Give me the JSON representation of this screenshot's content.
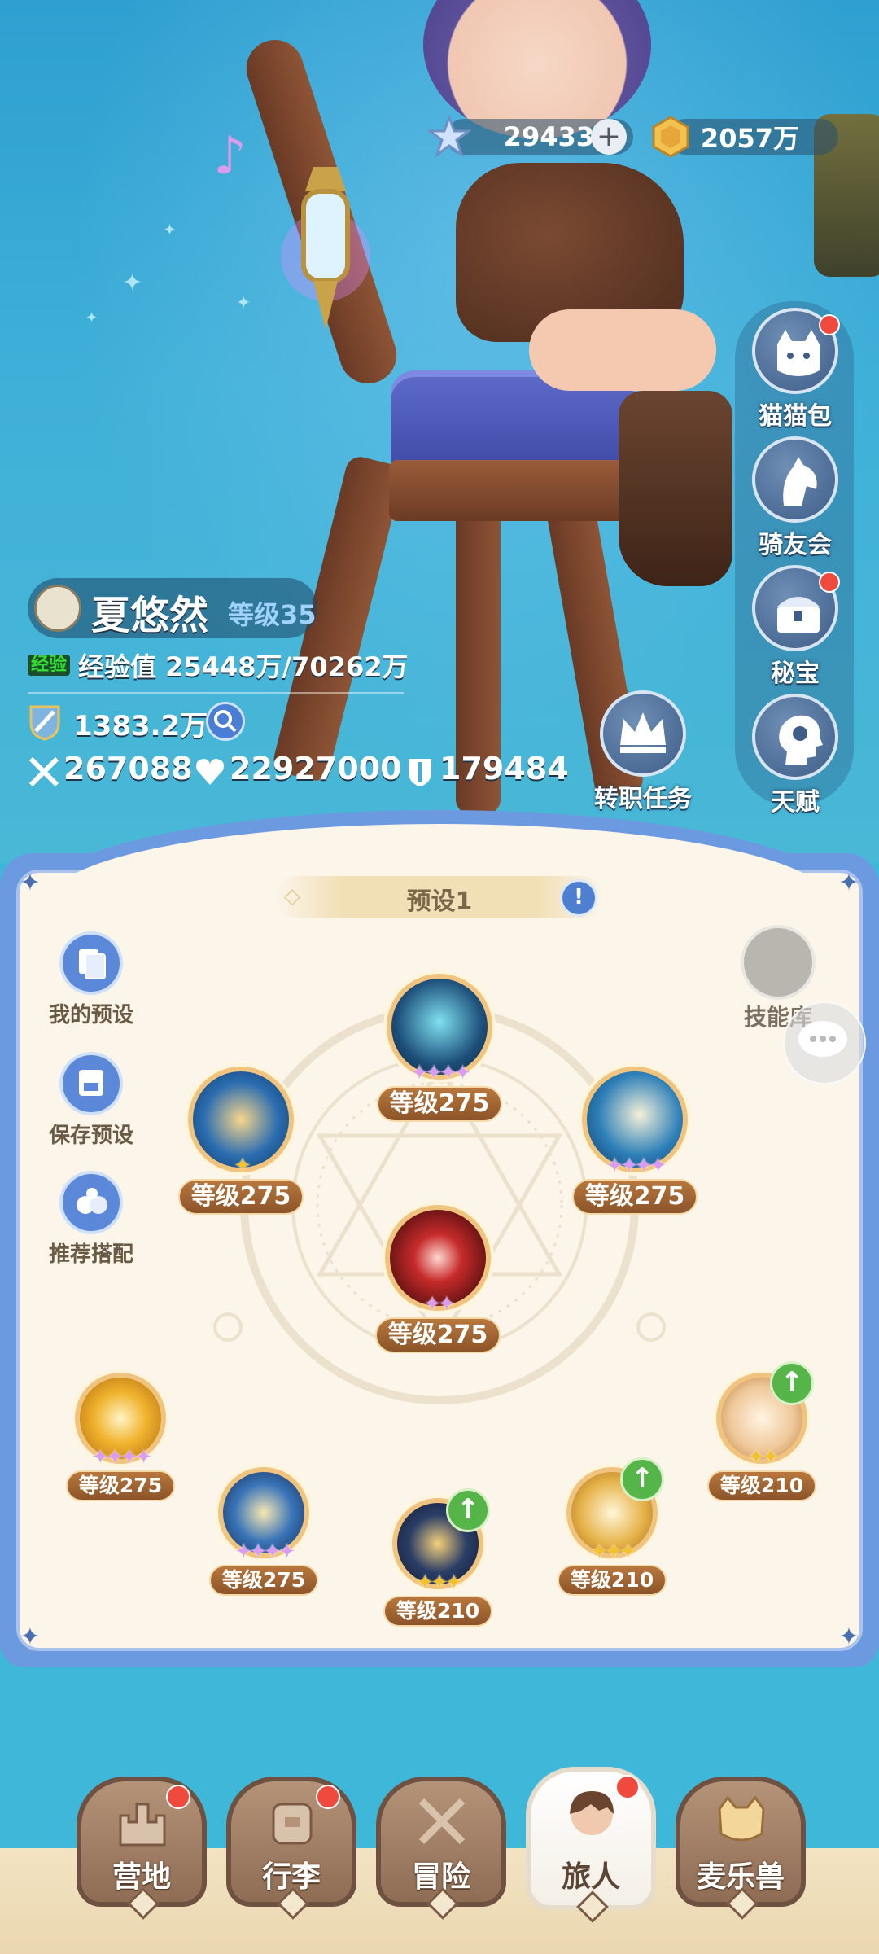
{
  "currency": {
    "stars": "29433",
    "gold": "2057万"
  },
  "side_menu": [
    {
      "label": "猫猫包",
      "badge": true
    },
    {
      "label": "骑友会",
      "badge": false
    },
    {
      "label": "秘宝",
      "badge": true
    },
    {
      "label": "天赋",
      "badge": false
    }
  ],
  "player": {
    "name": "夏悠然",
    "level": "等级35",
    "exp_tag": "经验",
    "exp": "经验值 25448万/70262万",
    "power": "1383.2万",
    "attack": "267088",
    "hp": "22927000",
    "defense": "179484"
  },
  "job_quest": "转职任务",
  "panel": {
    "preset_name": "预设1",
    "my_preset": "我的预设",
    "save_preset": "保存预设",
    "recommend": "推荐搭配",
    "skill_library": "技能库"
  },
  "skills": [
    {
      "level": "等级275",
      "stars": "✦✦✦✦",
      "star_color": "pink",
      "theme": "#1d4f7a"
    },
    {
      "level": "等级275",
      "stars": "✦",
      "star_color": "gold",
      "theme": "#2a6db0"
    },
    {
      "level": "等级275",
      "stars": "✦✦✦✦",
      "star_color": "pink",
      "theme": "#2d7fb8"
    },
    {
      "level": "等级275",
      "stars": "✦✦",
      "star_color": "pink",
      "theme": "#8a1c1c"
    },
    {
      "level": "等级275",
      "stars": "✦✦✦✦",
      "star_color": "pink",
      "theme": "#d89a1e"
    },
    {
      "level": "等级275",
      "stars": "✦✦✦✦",
      "star_color": "pink",
      "theme": "#234f8a"
    },
    {
      "level": "等级210",
      "stars": "✦✦✦",
      "star_color": "gold",
      "theme": "#2b3e66"
    },
    {
      "level": "等级210",
      "stars": "✦✦✦",
      "star_color": "gold",
      "theme": "#e6b34a"
    },
    {
      "level": "等级210",
      "stars": "✦✦",
      "star_color": "gold",
      "theme": "#efc89a"
    }
  ],
  "nav": [
    {
      "label": "营地",
      "badge": true,
      "active": false
    },
    {
      "label": "行李",
      "badge": true,
      "active": false
    },
    {
      "label": "冒险",
      "badge": false,
      "active": false
    },
    {
      "label": "旅人",
      "badge": true,
      "active": true
    },
    {
      "label": "麦乐兽",
      "badge": false,
      "active": false
    }
  ]
}
